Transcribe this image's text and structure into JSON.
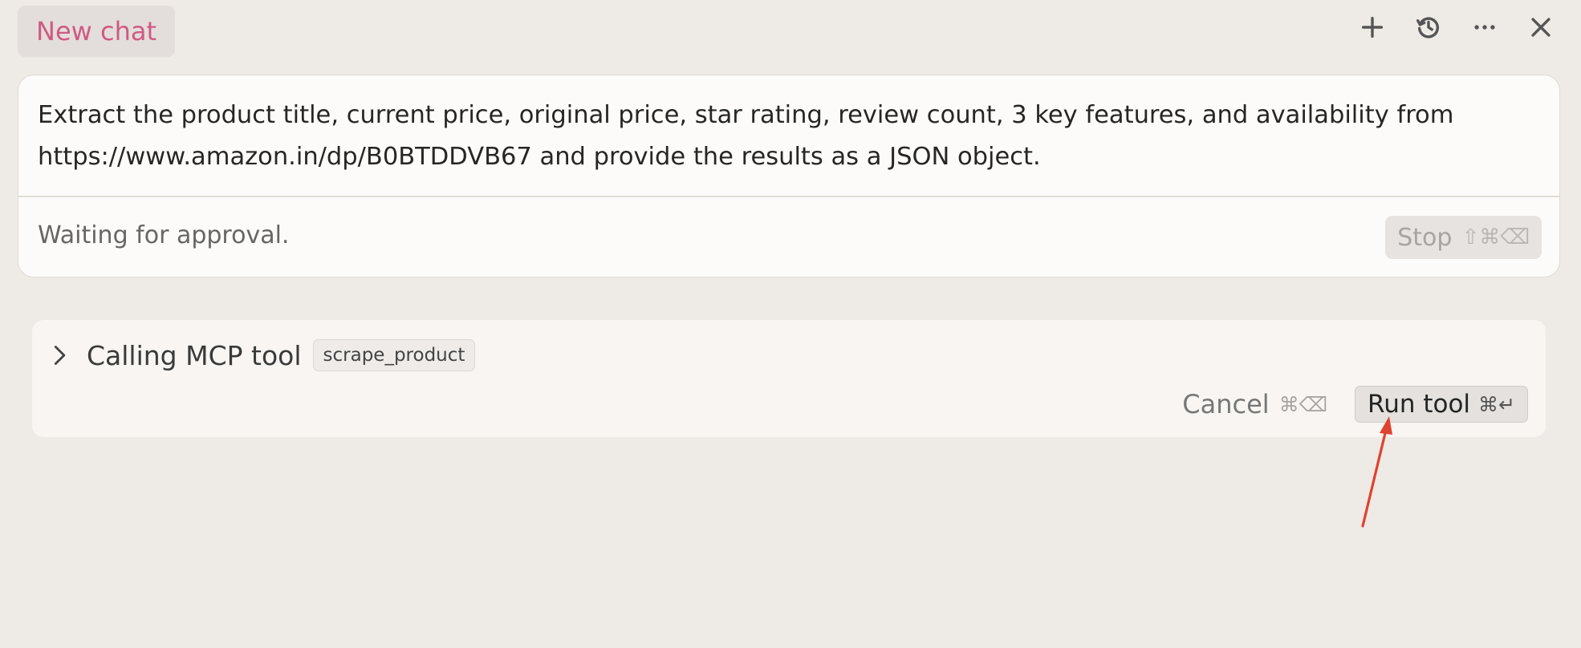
{
  "header": {
    "tab_label": "New chat",
    "tab_color": "#d05a83",
    "icons": [
      "plus-icon",
      "history-icon",
      "more-icon",
      "close-icon"
    ]
  },
  "prompt": {
    "text": "Extract the product title, current price, original price, star rating, review count, 3 key features, and availability from https://www.amazon.in/dp/B0BTDDVB67 and provide the results as a JSON object.",
    "status": "Waiting for approval.",
    "stop_label": "Stop",
    "stop_shortcut": "⇧⌘⌫"
  },
  "tool_call": {
    "title": "Calling MCP tool",
    "tool_name": "scrape_product",
    "cancel_label": "Cancel",
    "cancel_shortcut": "⌘⌫",
    "run_label": "Run tool",
    "run_shortcut": "⌘↵"
  },
  "annotation": {
    "color": "#e0422f"
  }
}
